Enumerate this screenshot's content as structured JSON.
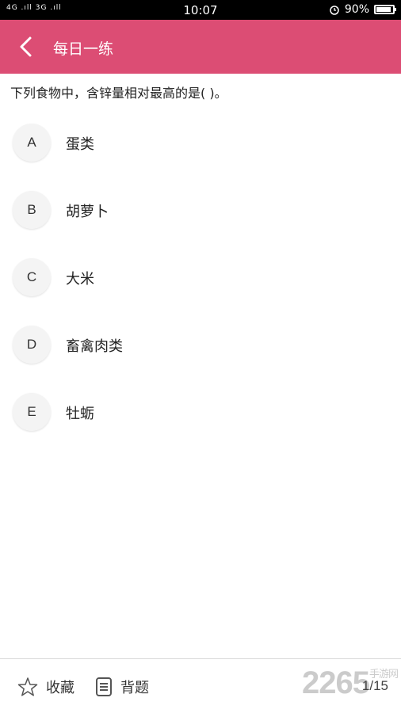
{
  "status_bar": {
    "signal": "4G .ıll 3G .ıll",
    "time": "10:07",
    "battery_percent": "90%",
    "battery_level": 0.9
  },
  "app_bar": {
    "title": "每日一练",
    "back_icon": "chevron-left-icon",
    "background": "#dc4d74"
  },
  "question": {
    "text": "下列食物中，含锌量相对最高的是( )。"
  },
  "options": [
    {
      "letter": "A",
      "text": "蛋类"
    },
    {
      "letter": "B",
      "text": "胡萝卜"
    },
    {
      "letter": "C",
      "text": "大米"
    },
    {
      "letter": "D",
      "text": "畜禽肉类"
    },
    {
      "letter": "E",
      "text": "牡蛎"
    }
  ],
  "bottom_bar": {
    "favorite_label": "收藏",
    "favorite_icon": "star-outline-icon",
    "memorize_label": "背题",
    "memorize_icon": "document-icon",
    "progress": "1/15"
  },
  "watermark": {
    "text": "2265",
    "suffix": "手游网"
  }
}
